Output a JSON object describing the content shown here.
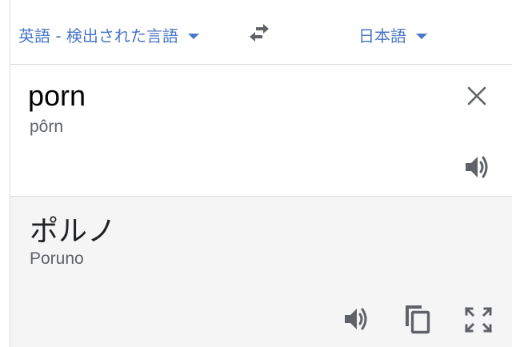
{
  "languages": {
    "source_label": "英語 - 検出された言語",
    "target_label": "日本語"
  },
  "source": {
    "text": "porn",
    "transliteration": "pôrn"
  },
  "result": {
    "text": "ポルノ",
    "transliteration": "Poruno"
  },
  "icons": {
    "dropdown": "caret-down-icon",
    "swap": "swap-arrows-icon",
    "close": "close-icon",
    "speaker": "speaker-icon",
    "copy": "copy-icon",
    "fullscreen": "fullscreen-icon"
  },
  "colors": {
    "accent": "#4a77c7",
    "icon": "#5f6368",
    "result_bg": "#f5f5f5"
  }
}
